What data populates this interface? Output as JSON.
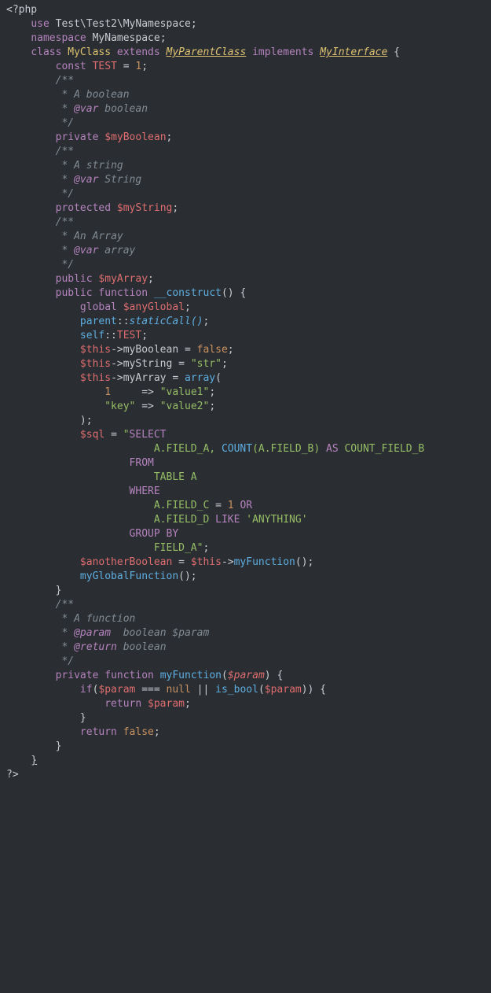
{
  "lines": [
    [
      [
        "tag",
        "<?php"
      ]
    ],
    [
      [
        "",
        "    "
      ],
      [
        "kw",
        "use"
      ],
      [
        "",
        " "
      ],
      [
        "ns",
        "Test\\Test2\\MyNamespace"
      ],
      [
        "punct",
        ";"
      ]
    ],
    [
      [
        "",
        "    "
      ],
      [
        "kw",
        "namespace"
      ],
      [
        "",
        " "
      ],
      [
        "ns",
        "MyNamespace"
      ],
      [
        "punct",
        ";"
      ]
    ],
    [
      [
        "",
        ""
      ]
    ],
    [
      [
        "",
        "    "
      ],
      [
        "kw",
        "class"
      ],
      [
        "",
        " "
      ],
      [
        "cls",
        "MyClass"
      ],
      [
        "",
        " "
      ],
      [
        "kw",
        "extends"
      ],
      [
        "",
        " "
      ],
      [
        "cls italic underline",
        "MyParentClass"
      ],
      [
        "",
        " "
      ],
      [
        "kw",
        "implements"
      ],
      [
        "",
        " "
      ],
      [
        "cls italic underline",
        "MyInterface"
      ],
      [
        "",
        " "
      ],
      [
        "punct",
        "{"
      ]
    ],
    [
      [
        "",
        ""
      ]
    ],
    [
      [
        "",
        "        "
      ],
      [
        "kw",
        "const"
      ],
      [
        "",
        " "
      ],
      [
        "const",
        "TEST"
      ],
      [
        "",
        " "
      ],
      [
        "op",
        "="
      ],
      [
        "",
        " "
      ],
      [
        "num",
        "1"
      ],
      [
        "punct",
        ";"
      ]
    ],
    [
      [
        "",
        ""
      ]
    ],
    [
      [
        "",
        "        "
      ],
      [
        "cmt",
        "/**"
      ]
    ],
    [
      [
        "",
        "        "
      ],
      [
        "cmt",
        " * A boolean"
      ]
    ],
    [
      [
        "",
        "        "
      ],
      [
        "cmt",
        " * "
      ],
      [
        "at",
        "@var"
      ],
      [
        "cmt",
        " boolean"
      ]
    ],
    [
      [
        "",
        "        "
      ],
      [
        "cmt",
        " */"
      ]
    ],
    [
      [
        "",
        "        "
      ],
      [
        "kw",
        "private"
      ],
      [
        "",
        " "
      ],
      [
        "var",
        "$myBoolean"
      ],
      [
        "punct",
        ";"
      ]
    ],
    [
      [
        "",
        ""
      ]
    ],
    [
      [
        "",
        "        "
      ],
      [
        "cmt",
        "/**"
      ]
    ],
    [
      [
        "",
        "        "
      ],
      [
        "cmt",
        " * A string"
      ]
    ],
    [
      [
        "",
        "        "
      ],
      [
        "cmt",
        " * "
      ],
      [
        "at",
        "@var"
      ],
      [
        "cmt",
        " String"
      ]
    ],
    [
      [
        "",
        "        "
      ],
      [
        "cmt",
        " */"
      ]
    ],
    [
      [
        "",
        "        "
      ],
      [
        "kw",
        "protected"
      ],
      [
        "",
        " "
      ],
      [
        "var",
        "$myString"
      ],
      [
        "punct",
        ";"
      ]
    ],
    [
      [
        "",
        ""
      ]
    ],
    [
      [
        "",
        "        "
      ],
      [
        "cmt",
        "/**"
      ]
    ],
    [
      [
        "",
        "        "
      ],
      [
        "cmt",
        " * An Array"
      ]
    ],
    [
      [
        "",
        "        "
      ],
      [
        "cmt",
        " * "
      ],
      [
        "at",
        "@var"
      ],
      [
        "cmt",
        " array"
      ]
    ],
    [
      [
        "",
        "        "
      ],
      [
        "cmt",
        " */"
      ]
    ],
    [
      [
        "",
        "        "
      ],
      [
        "kw",
        "public"
      ],
      [
        "",
        " "
      ],
      [
        "var",
        "$myArray"
      ],
      [
        "punct",
        ";"
      ]
    ],
    [
      [
        "",
        ""
      ]
    ],
    [
      [
        "",
        "        "
      ],
      [
        "kw",
        "public"
      ],
      [
        "",
        " "
      ],
      [
        "kw",
        "function"
      ],
      [
        "",
        " "
      ],
      [
        "fn",
        "__construct"
      ],
      [
        "punct",
        "()"
      ],
      [
        "",
        " "
      ],
      [
        "punct",
        "{"
      ]
    ],
    [
      [
        "",
        "            "
      ],
      [
        "kw",
        "global"
      ],
      [
        "",
        " "
      ],
      [
        "var",
        "$anyGlobal"
      ],
      [
        "punct",
        ";"
      ]
    ],
    [
      [
        "",
        ""
      ]
    ],
    [
      [
        "",
        "            "
      ],
      [
        "self",
        "parent"
      ],
      [
        "op",
        "::"
      ],
      [
        "fn italic",
        "staticCall()"
      ],
      [
        "punct",
        ";"
      ]
    ],
    [
      [
        "",
        ""
      ]
    ],
    [
      [
        "",
        "            "
      ],
      [
        "self",
        "self"
      ],
      [
        "op",
        "::"
      ],
      [
        "const",
        "TEST"
      ],
      [
        "punct",
        ";"
      ]
    ],
    [
      [
        "",
        ""
      ]
    ],
    [
      [
        "",
        "            "
      ],
      [
        "var",
        "$this"
      ],
      [
        "op",
        "->"
      ],
      [
        "prop",
        "myBoolean"
      ],
      [
        "",
        " "
      ],
      [
        "op",
        "="
      ],
      [
        "",
        " "
      ],
      [
        "num",
        "false"
      ],
      [
        "punct",
        ";"
      ]
    ],
    [
      [
        "",
        ""
      ]
    ],
    [
      [
        "",
        "            "
      ],
      [
        "var",
        "$this"
      ],
      [
        "op",
        "->"
      ],
      [
        "prop",
        "myString"
      ],
      [
        "",
        " "
      ],
      [
        "op",
        "="
      ],
      [
        "",
        " "
      ],
      [
        "str",
        "\"str\""
      ],
      [
        "punct",
        ";"
      ]
    ],
    [
      [
        "",
        ""
      ]
    ],
    [
      [
        "",
        "            "
      ],
      [
        "var",
        "$this"
      ],
      [
        "op",
        "->"
      ],
      [
        "prop",
        "myArray"
      ],
      [
        "",
        " "
      ],
      [
        "op",
        "="
      ],
      [
        "",
        " "
      ],
      [
        "fn",
        "array"
      ],
      [
        "punct",
        "("
      ]
    ],
    [
      [
        "",
        "                "
      ],
      [
        "num",
        "1"
      ],
      [
        "",
        "     "
      ],
      [
        "op",
        "=>"
      ],
      [
        "",
        " "
      ],
      [
        "str",
        "\"value1\""
      ],
      [
        "punct",
        ";"
      ]
    ],
    [
      [
        "",
        "                "
      ],
      [
        "str",
        "\"key\""
      ],
      [
        "",
        " "
      ],
      [
        "op",
        "=>"
      ],
      [
        "",
        " "
      ],
      [
        "str",
        "\"value2\""
      ],
      [
        "punct",
        ";"
      ]
    ],
    [
      [
        "",
        "            "
      ],
      [
        "punct",
        ");"
      ]
    ],
    [
      [
        "",
        ""
      ]
    ],
    [
      [
        "",
        "            "
      ],
      [
        "var",
        "$sql"
      ],
      [
        "",
        " "
      ],
      [
        "op",
        "="
      ],
      [
        "",
        " "
      ],
      [
        "str",
        "\""
      ],
      [
        "sqlkw",
        "SELECT"
      ]
    ],
    [
      [
        "",
        "                        "
      ],
      [
        "str",
        "A.FIELD_A, "
      ],
      [
        "sqlfn",
        "COUNT"
      ],
      [
        "str",
        "(A.FIELD_B) "
      ],
      [
        "sqlkw",
        "AS"
      ],
      [
        "str",
        " COUNT_FIELD_B"
      ]
    ],
    [
      [
        "",
        "                    "
      ],
      [
        "sqlkw",
        "FROM"
      ]
    ],
    [
      [
        "",
        "                        "
      ],
      [
        "str",
        "TABLE A"
      ]
    ],
    [
      [
        "",
        "                    "
      ],
      [
        "sqlkw",
        "WHERE"
      ]
    ],
    [
      [
        "",
        "                        "
      ],
      [
        "str",
        "A.FIELD_C "
      ],
      [
        "op",
        "="
      ],
      [
        "",
        " "
      ],
      [
        "num",
        "1"
      ],
      [
        "",
        " "
      ],
      [
        "sqlkw",
        "OR"
      ]
    ],
    [
      [
        "",
        "                        "
      ],
      [
        "str",
        "A.FIELD_D "
      ],
      [
        "sqlkw",
        "LIKE"
      ],
      [
        "",
        " "
      ],
      [
        "str",
        "'ANYTHING'"
      ]
    ],
    [
      [
        "",
        "                    "
      ],
      [
        "sqlkw",
        "GROUP BY"
      ]
    ],
    [
      [
        "",
        "                        "
      ],
      [
        "str",
        "FIELD_A"
      ],
      [
        "str",
        "\""
      ],
      [
        "punct",
        ";"
      ]
    ],
    [
      [
        "",
        ""
      ]
    ],
    [
      [
        "",
        "            "
      ],
      [
        "var",
        "$anotherBoolean"
      ],
      [
        "",
        " "
      ],
      [
        "op",
        "="
      ],
      [
        "",
        " "
      ],
      [
        "var",
        "$this"
      ],
      [
        "op",
        "->"
      ],
      [
        "fn",
        "myFunction"
      ],
      [
        "punct",
        "();"
      ]
    ],
    [
      [
        "",
        ""
      ]
    ],
    [
      [
        "",
        "            "
      ],
      [
        "fn",
        "myGlobalFunction"
      ],
      [
        "punct",
        "();"
      ]
    ],
    [
      [
        "",
        "        "
      ],
      [
        "punct",
        "}"
      ]
    ],
    [
      [
        "",
        ""
      ]
    ],
    [
      [
        "",
        "        "
      ],
      [
        "cmt",
        "/**"
      ]
    ],
    [
      [
        "",
        "        "
      ],
      [
        "cmt",
        " * A function"
      ]
    ],
    [
      [
        "",
        "        "
      ],
      [
        "cmt",
        " * "
      ],
      [
        "at",
        "@param"
      ],
      [
        "cmt",
        "  boolean $param"
      ]
    ],
    [
      [
        "",
        "        "
      ],
      [
        "cmt",
        " * "
      ],
      [
        "at",
        "@return"
      ],
      [
        "cmt",
        " boolean"
      ]
    ],
    [
      [
        "",
        "        "
      ],
      [
        "cmt",
        " */"
      ]
    ],
    [
      [
        "",
        "        "
      ],
      [
        "kw",
        "private"
      ],
      [
        "",
        " "
      ],
      [
        "kw",
        "function"
      ],
      [
        "",
        " "
      ],
      [
        "fn",
        "myFunction"
      ],
      [
        "punct",
        "("
      ],
      [
        "var italic",
        "$param"
      ],
      [
        "punct",
        ")"
      ],
      [
        "",
        " "
      ],
      [
        "punct",
        "{"
      ]
    ],
    [
      [
        "",
        "            "
      ],
      [
        "kw",
        "if"
      ],
      [
        "punct",
        "("
      ],
      [
        "var",
        "$param"
      ],
      [
        "",
        " "
      ],
      [
        "op",
        "==="
      ],
      [
        "",
        " "
      ],
      [
        "num",
        "null"
      ],
      [
        "",
        " "
      ],
      [
        "op",
        "||"
      ],
      [
        "",
        " "
      ],
      [
        "fn",
        "is_bool"
      ],
      [
        "punct",
        "("
      ],
      [
        "var",
        "$param"
      ],
      [
        "punct",
        "))"
      ],
      [
        "",
        " "
      ],
      [
        "punct",
        "{"
      ]
    ],
    [
      [
        "",
        "                "
      ],
      [
        "kw",
        "return"
      ],
      [
        "",
        " "
      ],
      [
        "var",
        "$param"
      ],
      [
        "punct",
        ";"
      ]
    ],
    [
      [
        "",
        "            "
      ],
      [
        "punct",
        "}"
      ]
    ],
    [
      [
        "",
        "            "
      ],
      [
        "kw",
        "return"
      ],
      [
        "",
        " "
      ],
      [
        "num",
        "false"
      ],
      [
        "punct",
        ";"
      ]
    ],
    [
      [
        "",
        "        "
      ],
      [
        "punct",
        "}"
      ]
    ],
    [
      [
        "",
        "    "
      ],
      [
        "punct underline",
        "}"
      ]
    ],
    [
      [
        "",
        ""
      ],
      [
        "tag",
        "?>"
      ]
    ]
  ]
}
